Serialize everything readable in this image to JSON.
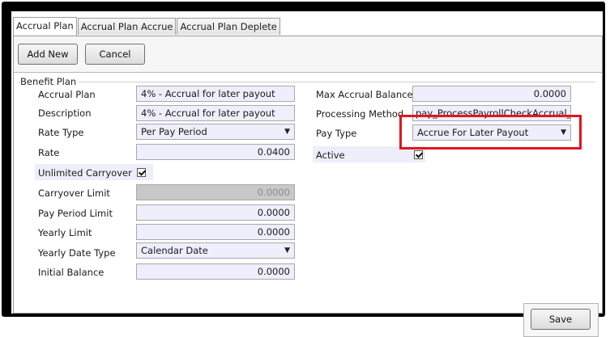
{
  "tabs": [
    "Accrual  Plan",
    "Accrual Plan Accrue",
    "Accrual Plan Deplete"
  ],
  "toolbar": {
    "add_new": "Add New",
    "cancel": "Cancel"
  },
  "group_title": "Benefit Plan",
  "left": {
    "accrual_plan": {
      "label": "Accrual Plan",
      "value": "4% - Accrual for later payout"
    },
    "description": {
      "label": "Description",
      "value": "4% - Accrual for later payout"
    },
    "rate_type": {
      "label": "Rate Type",
      "value": "Per Pay Period"
    },
    "rate": {
      "label": "Rate",
      "value": "0.0400"
    },
    "unlimited_carryover": {
      "label": "Unlimited Carryover",
      "checked": true
    },
    "carryover_limit": {
      "label": "Carryover Limit",
      "value": "0.0000"
    },
    "pay_period_limit": {
      "label": "Pay Period Limit",
      "value": "0.0000"
    },
    "yearly_limit": {
      "label": "Yearly Limit",
      "value": "0.0000"
    },
    "yearly_date_type": {
      "label": "Yearly Date Type",
      "value": "Calendar Date"
    },
    "initial_balance": {
      "label": "Initial Balance",
      "value": "0.0000"
    }
  },
  "right": {
    "max_accrual_balance": {
      "label": "Max Accrual Balance",
      "value": "0.0000"
    },
    "processing_method": {
      "label": "Processing Method",
      "value": "pay_ProcessPayrollCheckAccrual_CA"
    },
    "pay_type": {
      "label": "Pay Type",
      "value": "Accrue For Later Payout"
    },
    "active": {
      "label": "Active",
      "checked": true
    }
  },
  "save_label": "Save",
  "colors": {
    "field_bg": "#eeeefc",
    "highlight_border": "#e0161f",
    "disabled_bg": "#c8c8c8"
  },
  "icons": {
    "dropdown": "chevron-down-icon",
    "check": "checkmark-icon"
  }
}
